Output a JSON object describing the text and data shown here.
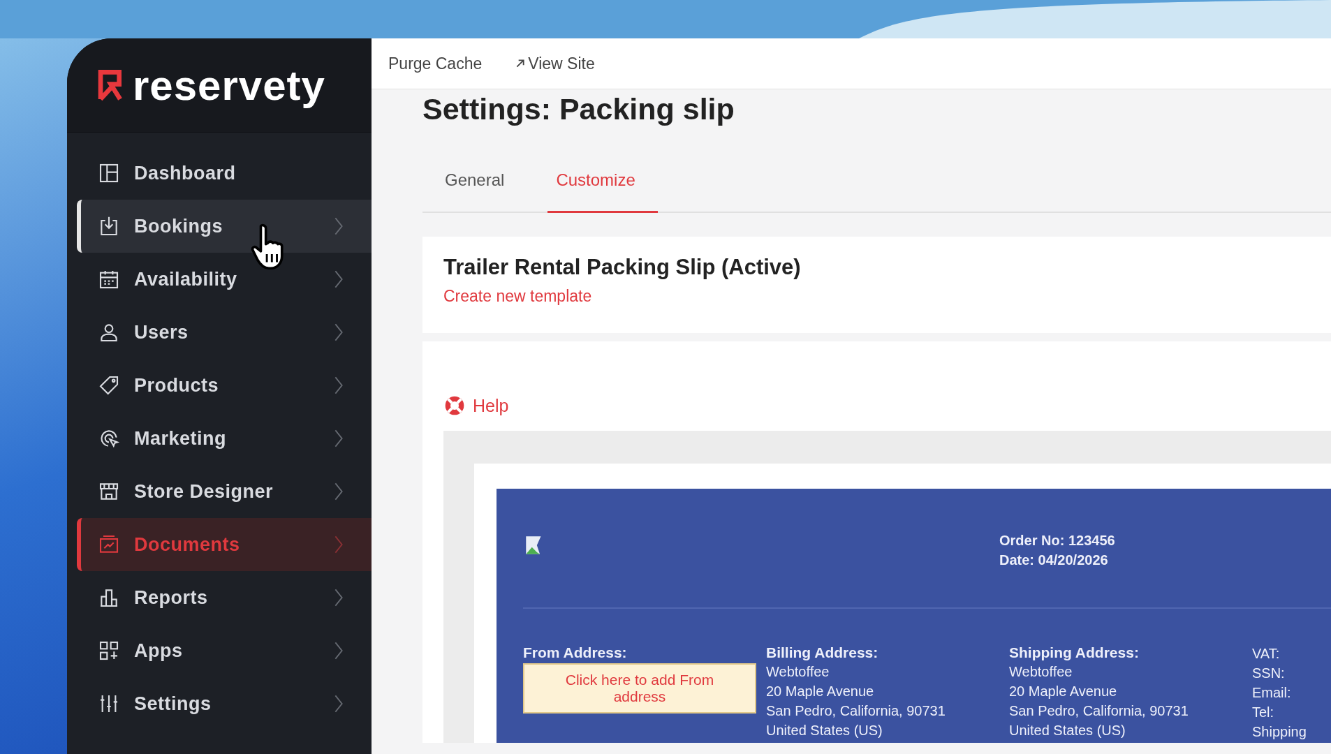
{
  "sidebar": {
    "logo": "reservety",
    "items": [
      {
        "label": "Dashboard",
        "selected": false,
        "hovered": false
      },
      {
        "label": "Bookings",
        "selected": false,
        "hovered": true
      },
      {
        "label": "Availability",
        "selected": false,
        "hovered": false
      },
      {
        "label": "Users",
        "selected": false,
        "hovered": false
      },
      {
        "label": "Products",
        "selected": false,
        "hovered": false
      },
      {
        "label": "Marketing",
        "selected": false,
        "hovered": false
      },
      {
        "label": "Store Designer",
        "selected": false,
        "hovered": false
      },
      {
        "label": "Documents",
        "selected": true,
        "hovered": false
      },
      {
        "label": "Reports",
        "selected": false,
        "hovered": false
      },
      {
        "label": "Apps",
        "selected": false,
        "hovered": false
      },
      {
        "label": "Settings",
        "selected": false,
        "hovered": false
      }
    ]
  },
  "topbar": {
    "links": [
      {
        "label": "Purge Cache"
      },
      {
        "label": "View Site"
      }
    ]
  },
  "page_title": "Settings: Packing slip",
  "tabs": [
    {
      "label": "General",
      "selected": false
    },
    {
      "label": "Customize",
      "selected": true
    }
  ],
  "template": {
    "title": "Trailer Rental Packing Slip (Active)",
    "link": "Create new template"
  },
  "help": "Help",
  "document": {
    "order_lines": [
      "Order No: 123456",
      "Date: 04/20/2026"
    ],
    "columns": [
      {
        "heading": "From Address:",
        "kind": "placeholder",
        "prompt": "Click here to add From address"
      },
      {
        "heading": "Billing Address:",
        "kind": "address",
        "lines": [
          "Webtoffee",
          "20 Maple Avenue",
          "San Pedro, California, 90731",
          "United States (US)"
        ]
      },
      {
        "heading": "Shipping Address:",
        "kind": "address",
        "lines": [
          "Webtoffee",
          "20 Maple Avenue",
          "San Pedro, California, 90731",
          "United States (US)"
        ]
      },
      {
        "kind": "address",
        "lines": [
          "VAT:",
          "SSN:",
          "Email:",
          "Tel:",
          "Shipping"
        ]
      }
    ]
  }
}
